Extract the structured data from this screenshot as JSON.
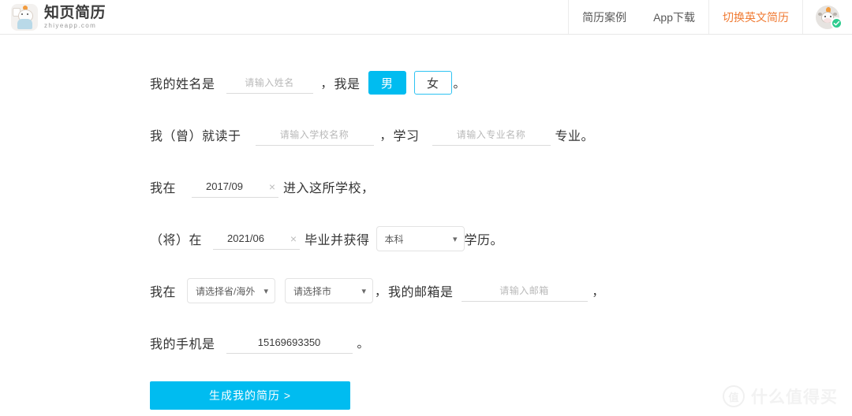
{
  "header": {
    "brand": {
      "name": "知页简历",
      "domain": "zhiyeapp.com",
      "logo_icon": "cow-logo-icon"
    },
    "nav": [
      {
        "label": "简历案例",
        "accent": false
      },
      {
        "label": "App下载",
        "accent": false
      },
      {
        "label": "切换英文简历",
        "accent": true
      }
    ],
    "avatar": {
      "icon": "user-avatar-cow-icon",
      "badge_icon": "verified-check-icon"
    }
  },
  "form": {
    "row_name": {
      "label": "我的姓名是",
      "name_placeholder": "请输入姓名",
      "comma": "，",
      "i_am": "我是",
      "gender_male": "男",
      "gender_female": "女",
      "period": "。"
    },
    "row_school": {
      "label": "我（曾）就读于",
      "school_placeholder": "请输入学校名称",
      "comma": "，",
      "study": "学习",
      "major_placeholder": "请输入专业名称",
      "suffix": "专业。"
    },
    "row_enroll": {
      "label": "我在",
      "date_value": "2017/09",
      "clear_icon": "×",
      "suffix": "进入这所学校，"
    },
    "row_graduate": {
      "label": "（将）在",
      "date_value": "2021/06",
      "clear_icon": "×",
      "middle": "毕业并获得",
      "degree_value": "本科",
      "suffix": "学历。"
    },
    "row_location": {
      "label": "我在",
      "province_value": "请选择省/海外",
      "city_value": "请选择市",
      "comma": "，",
      "email_label": "我的邮箱是",
      "email_placeholder": "请输入邮箱",
      "trailing_comma": "，"
    },
    "row_phone": {
      "label": "我的手机是",
      "phone_value": "15169693350",
      "period": "。"
    },
    "submit_label": "生成我的简历 >"
  },
  "watermark": {
    "mark": "值",
    "text": "什么值得买"
  },
  "colors": {
    "accent_cyan": "#00bcf0",
    "accent_orange": "#f07a32",
    "badge_green": "#2ecc8f",
    "text": "#333333",
    "placeholder": "#b9b9b9",
    "border": "#e3e3e3"
  }
}
